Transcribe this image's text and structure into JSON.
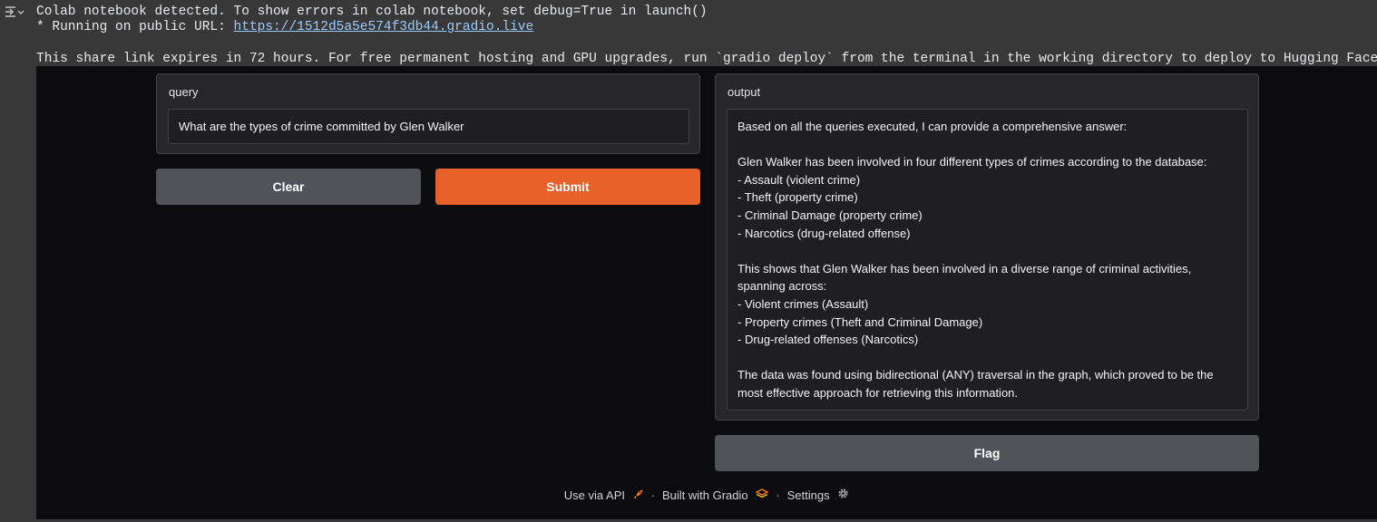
{
  "console": {
    "line1": "Colab notebook detected. To show errors in colab notebook, set debug=True in launch()",
    "line2_prefix": "* Running on public URL: ",
    "line2_url": "https://1512d5a5e574f3db44.gradio.live",
    "line3": "This share link expires in 72 hours. For free permanent hosting and GPU upgrades, run `gradio deploy` from the terminal in the working directory to deploy to Hugging Face Spaces"
  },
  "query": {
    "label": "query",
    "value": "What are the types of crime committed by Glen Walker"
  },
  "buttons": {
    "clear": "Clear",
    "submit": "Submit",
    "flag": "Flag"
  },
  "output": {
    "label": "output",
    "lines": [
      "Based on all the queries executed, I can provide a comprehensive answer:",
      "",
      "Glen Walker has been involved in four different types of crimes according to the database:",
      "- Assault (violent crime)",
      "- Theft (property crime)",
      "- Criminal Damage (property crime)",
      "- Narcotics (drug-related offense)",
      "",
      "This shows that Glen Walker has been involved in a diverse range of criminal activities,",
      "spanning across:",
      "- Violent crimes (Assault)",
      "- Property crimes (Theft and Criminal Damage)",
      "- Drug-related offenses (Narcotics)",
      "",
      "The data was found using bidirectional (ANY) traversal in the graph, which proved to be the",
      "most effective approach for retrieving this information."
    ]
  },
  "footer": {
    "api": "Use via API",
    "sep1": "·",
    "built": "Built with Gradio",
    "sep2": "·",
    "settings": "Settings"
  },
  "colors": {
    "primary": "#e8612b",
    "secondary": "#52525b",
    "background": "#0c0c0f",
    "panel": "#27272a"
  }
}
